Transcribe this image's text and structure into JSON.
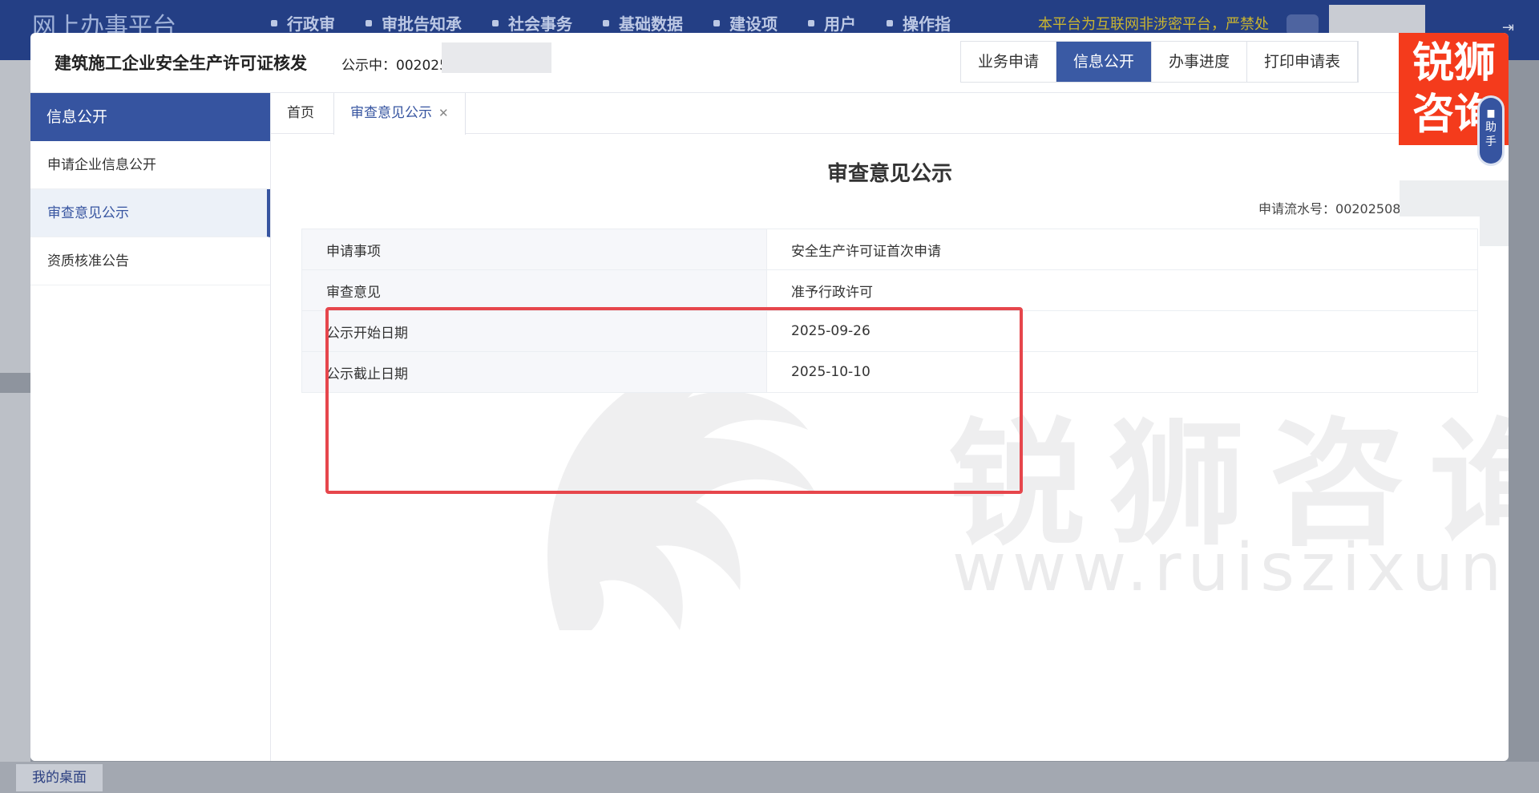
{
  "background": {
    "logo": "网上办事平台",
    "nav": [
      "行政审",
      "审批告知承",
      "社会事务",
      "基础数据",
      "建设项",
      "用户",
      "操作指"
    ],
    "notice": "本平台为互联网非涉密平台，严禁处",
    "bottom_tab": "我的桌面"
  },
  "modal": {
    "title": "建筑施工企业安全生产许可证核发",
    "publicity_label": "公示中：",
    "publicity_number": "002025",
    "buttons": [
      "业务申请",
      "信息公开",
      "办事进度",
      "打印申请表"
    ],
    "active_button": "信息公开"
  },
  "sidebar": {
    "header": "信息公开",
    "items": [
      {
        "label": "申请企业信息公开"
      },
      {
        "label": "审查意见公示"
      },
      {
        "label": "资质核准公告"
      }
    ],
    "active_item": "审查意见公示"
  },
  "tabs": {
    "home": "首页",
    "current": "审查意见公示"
  },
  "content": {
    "title": "审查意见公示",
    "serial_label": "申请流水号：",
    "serial_value": "00202508",
    "rows": [
      {
        "key": "申请事项",
        "value": "安全生产许可证首次申请"
      },
      {
        "key": "审查意见",
        "value": "准予行政许可"
      },
      {
        "key": "公示开始日期",
        "value": "2025-09-26"
      },
      {
        "key": "公示截止日期",
        "value": "2025-10-10"
      }
    ]
  },
  "watermark": {
    "text": "锐狮咨询",
    "url": "www.ruiszixun.com"
  },
  "badge": {
    "line1": "锐狮",
    "line2": "咨询"
  },
  "helper": {
    "label": "助手"
  },
  "colors": {
    "primary": "#3654a0",
    "highlight": "#e6464c",
    "badge": "#f43b1c"
  }
}
